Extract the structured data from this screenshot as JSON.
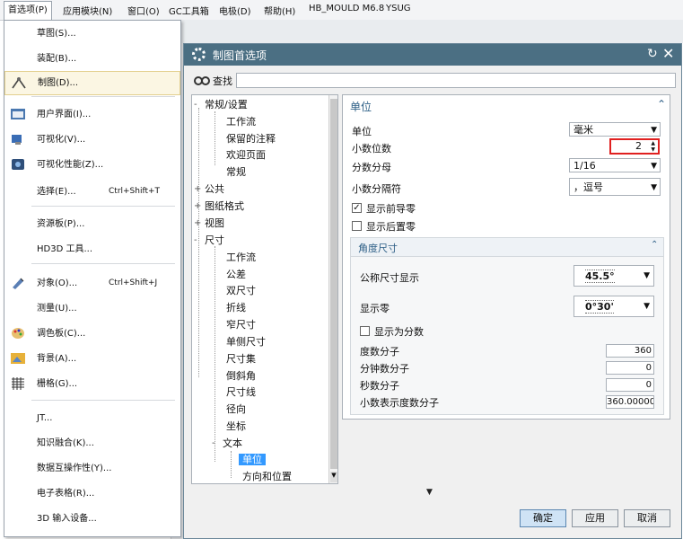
{
  "menubar": {
    "items": [
      {
        "label": "首选项(P)",
        "active": true
      },
      {
        "label": "应用模块(N)"
      },
      {
        "label": "窗口(O)"
      },
      {
        "label": "GC工具箱"
      },
      {
        "label": "电极(D)"
      },
      {
        "label": "帮助(H)"
      },
      {
        "label": "HB_MOULD M6.8"
      },
      {
        "label": "YSUG"
      }
    ]
  },
  "dropdown": {
    "items": [
      {
        "label": "草图(S)..."
      },
      {
        "label": "装配(B)..."
      },
      {
        "label": "制图(D)...",
        "icon": "drafting-icon",
        "highlighted": true
      },
      {
        "label": "用户界面(I)...",
        "icon": "user-interface-icon"
      },
      {
        "label": "可视化(V)...",
        "icon": "visualization-icon"
      },
      {
        "label": "可视化性能(Z)...",
        "icon": "visualization-performance-icon"
      },
      {
        "label": "选择(E)...",
        "shortcut": "Ctrl+Shift+T"
      },
      {
        "label": "资源板(P)..."
      },
      {
        "label": "HD3D 工具..."
      },
      {
        "label": "对象(O)...",
        "shortcut": "Ctrl+Shift+J",
        "icon": "object-icon"
      },
      {
        "label": "测量(U)..."
      },
      {
        "label": "调色板(C)...",
        "icon": "palette-icon"
      },
      {
        "label": "背景(A)...",
        "icon": "background-icon"
      },
      {
        "label": "栅格(G)...",
        "icon": "grid-icon"
      },
      {
        "label": "JT..."
      },
      {
        "label": "知识融合(K)..."
      },
      {
        "label": "数据互操作性(Y)..."
      },
      {
        "label": "电子表格(R)..."
      },
      {
        "label": "3D 输入设备..."
      }
    ]
  },
  "dialog": {
    "title": "制图首选项",
    "find_label": "查找",
    "find_value": "",
    "tree": [
      {
        "label": "常规/设置",
        "toggle": "-"
      },
      {
        "label": "工作流"
      },
      {
        "label": "保留的注释"
      },
      {
        "label": "欢迎页面"
      },
      {
        "label": "常规"
      },
      {
        "label": "公共",
        "toggle": "+"
      },
      {
        "label": "图纸格式",
        "toggle": "+"
      },
      {
        "label": "视图",
        "toggle": "+"
      },
      {
        "label": "尺寸",
        "toggle": "-"
      },
      {
        "label": "工作流"
      },
      {
        "label": "公差"
      },
      {
        "label": "双尺寸"
      },
      {
        "label": "折线"
      },
      {
        "label": "窄尺寸"
      },
      {
        "label": "单侧尺寸"
      },
      {
        "label": "尺寸集"
      },
      {
        "label": "倒斜角"
      },
      {
        "label": "尺寸线"
      },
      {
        "label": "径向"
      },
      {
        "label": "坐标"
      },
      {
        "label": "文本",
        "toggle": "-"
      },
      {
        "label": "单位",
        "selected": true
      },
      {
        "label": "方向和位置"
      }
    ],
    "panel": {
      "section_title": "单位",
      "unit_label": "单位",
      "unit_value": "毫米",
      "decimals_label": "小数位数",
      "decimals_value": "2",
      "fraction_label": "分数分母",
      "fraction_value": "1/16",
      "separator_label": "小数分隔符",
      "separator_value": "，逗号",
      "show_leading_zero": "显示前导零",
      "show_leading_zero_checked": true,
      "show_trailing_zero": "显示后置零",
      "show_trailing_zero_checked": false,
      "angle": {
        "title": "角度尺寸",
        "nominal_label": "公称尺寸显示",
        "nominal_value": "45.5°",
        "show_zero_label": "显示零",
        "show_zero_value": "0°30'",
        "as_fraction_label": "显示为分数",
        "as_fraction_checked": false,
        "degree_num_label": "度数分子",
        "degree_num_value": "360",
        "minute_num_label": "分钟数分子",
        "minute_num_value": "0",
        "second_num_label": "秒数分子",
        "second_num_value": "0",
        "decimal_degree_label": "小数表示度数分子",
        "decimal_degree_value": "360.00000"
      }
    },
    "buttons": {
      "ok": "确定",
      "apply": "应用",
      "cancel": "取消"
    }
  },
  "colors": {
    "titlebar": "#4b6f83",
    "selection": "#3399ff",
    "highlight_box": "#e02020"
  }
}
